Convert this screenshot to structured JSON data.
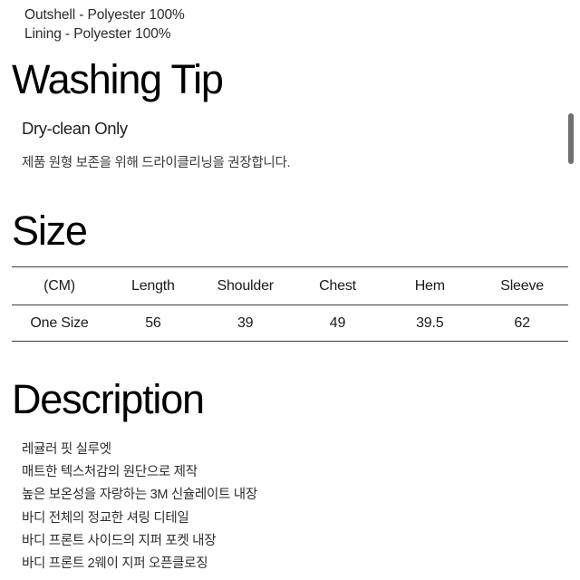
{
  "material": {
    "lines": [
      "Outshell - Polyester 100%",
      "Lining - Polyester 100%"
    ]
  },
  "washing": {
    "heading": "Washing Tip",
    "subheading": "Dry-clean Only",
    "note": "제품 원형 보존을 위해 드라이클리닝을 권장합니다."
  },
  "size": {
    "heading": "Size",
    "columns": [
      "(CM)",
      "Length",
      "Shoulder",
      "Chest",
      "Hem",
      "Sleeve"
    ],
    "rows": [
      [
        "One Size",
        "56",
        "39",
        "49",
        "39.5",
        "62"
      ]
    ]
  },
  "description": {
    "heading": "Description",
    "items": [
      "레귤러 핏 실루엣",
      "매트한 텍스처감의 원단으로 제작",
      "높은 보온성을 자랑하는 3M 신슐레이트 내장",
      "바디 전체의 정교한 셔링 디테일",
      "바디 프론트 사이드의 지퍼 포켓 내장",
      "바디 프론트 2웨이 지퍼 오픈클로징"
    ]
  },
  "scrollbar": {
    "thumb_color": "#707070"
  },
  "theme": {
    "background": "#ffffff",
    "text": "#1a1a1a",
    "rule": "#3d3d3d"
  }
}
